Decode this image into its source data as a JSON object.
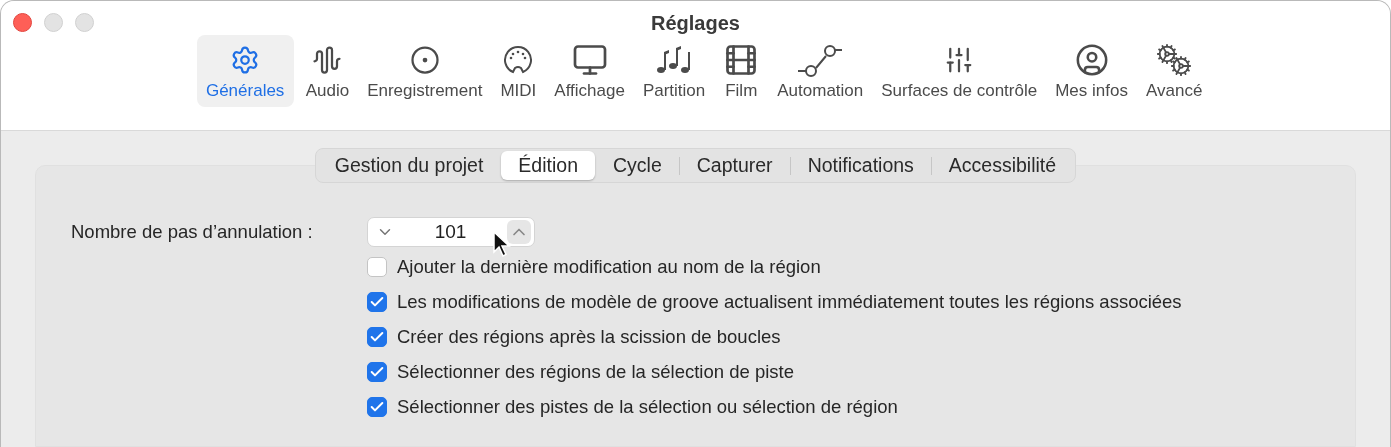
{
  "window": {
    "title": "Réglages"
  },
  "toolbar": [
    {
      "label": "Générales",
      "selected": true
    },
    {
      "label": "Audio",
      "selected": false
    },
    {
      "label": "Enregistrement",
      "selected": false
    },
    {
      "label": "MIDI",
      "selected": false
    },
    {
      "label": "Affichage",
      "selected": false
    },
    {
      "label": "Partition",
      "selected": false
    },
    {
      "label": "Film",
      "selected": false
    },
    {
      "label": "Automation",
      "selected": false
    },
    {
      "label": "Surfaces de contrôle",
      "selected": false
    },
    {
      "label": "Mes infos",
      "selected": false
    },
    {
      "label": "Avancé",
      "selected": false
    }
  ],
  "tabs": [
    {
      "label": "Gestion du projet",
      "selected": false
    },
    {
      "label": "Édition",
      "selected": true
    },
    {
      "label": "Cycle",
      "selected": false
    },
    {
      "label": "Capturer",
      "selected": false
    },
    {
      "label": "Notifications",
      "selected": false
    },
    {
      "label": "Accessibilité",
      "selected": false
    }
  ],
  "undo_steps": {
    "label": "Nombre de pas d’annulation :",
    "value": "101"
  },
  "options": [
    {
      "label": "Ajouter la dernière modification au nom de la région",
      "checked": false
    },
    {
      "label": "Les modifications de modèle de groove actualisent immédiatement toutes les régions associées",
      "checked": true
    },
    {
      "label": "Créer des régions après la scission de boucles",
      "checked": true
    },
    {
      "label": "Sélectionner des régions de la sélection de piste",
      "checked": true
    },
    {
      "label": "Sélectionner des pistes de la sélection ou sélection de région",
      "checked": true
    }
  ]
}
